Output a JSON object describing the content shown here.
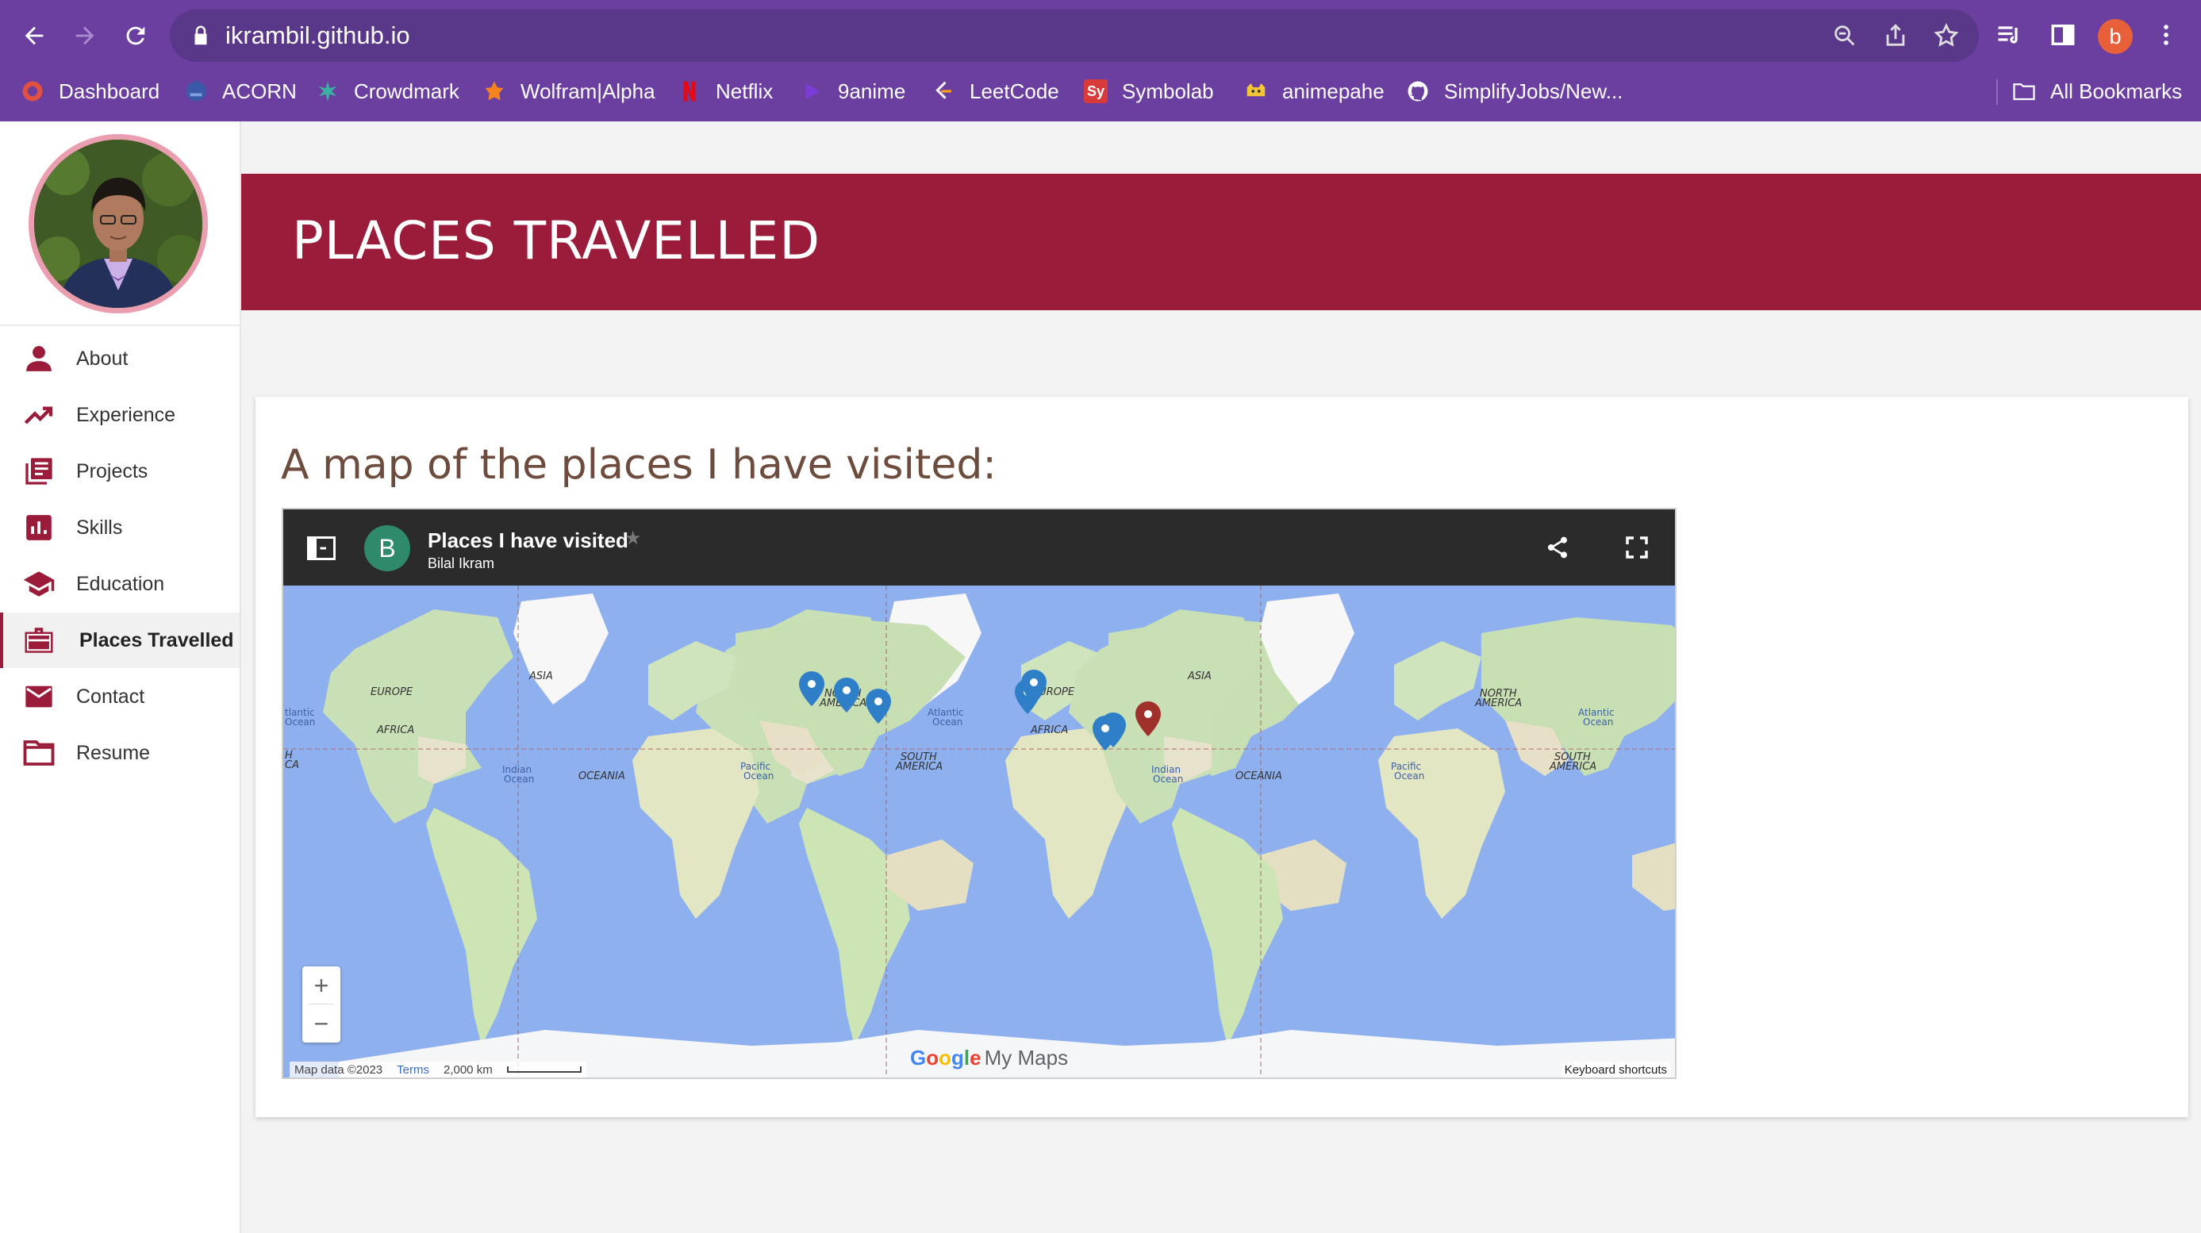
{
  "browser": {
    "url": "ikrambil.github.io",
    "profile_initial": "b",
    "bookmarks": [
      {
        "label": "Dashboard",
        "icon": "dashboard-favicon"
      },
      {
        "label": "ACORN",
        "icon": "acorn-favicon"
      },
      {
        "label": "Crowdmark",
        "icon": "crowdmark-favicon"
      },
      {
        "label": "Wolfram|Alpha",
        "icon": "wolfram-favicon"
      },
      {
        "label": "Netflix",
        "icon": "netflix-favicon"
      },
      {
        "label": "9anime",
        "icon": "9anime-favicon"
      },
      {
        "label": "LeetCode",
        "icon": "leetcode-favicon"
      },
      {
        "label": "Symbolab",
        "icon": "symbolab-favicon",
        "badge": "Sy"
      },
      {
        "label": "animepahe",
        "icon": "animepahe-favicon"
      },
      {
        "label": "SimplifyJobs/New...",
        "icon": "github-favicon"
      }
    ],
    "all_bookmarks_label": "All Bookmarks"
  },
  "sidebar": {
    "items": [
      {
        "label": "About",
        "icon": "person-icon"
      },
      {
        "label": "Experience",
        "icon": "trending-up-icon"
      },
      {
        "label": "Projects",
        "icon": "library-icon"
      },
      {
        "label": "Skills",
        "icon": "bar-chart-icon"
      },
      {
        "label": "Education",
        "icon": "graduation-cap-icon"
      },
      {
        "label": "Places Travelled",
        "icon": "briefcase-icon",
        "active": true
      },
      {
        "label": "Contact",
        "icon": "mail-icon"
      },
      {
        "label": "Resume",
        "icon": "folder-icon"
      }
    ]
  },
  "main": {
    "banner_title": "PLACES TRAVELLED",
    "section_heading": "A map of the places I have visited:"
  },
  "map": {
    "title": "Places I have visited",
    "owner": "Bilal Ikram",
    "owner_initial": "B",
    "labels": {
      "asia": "ASIA",
      "europe": "EUROPE",
      "africa": "AFRICA",
      "north_america_1": "NORTH",
      "north_america_2": "AMERICA",
      "south_america_1": "SOUTH",
      "south_america_2": "AMERICA",
      "oceania": "OCEANIA",
      "atlantic_1": "Atlantic",
      "atlantic_2": "Ocean",
      "indian_1": "Indian",
      "indian_2": "Ocean",
      "pacific_1": "Pacific",
      "pacific_2": "Ocean",
      "partial_atlantic_1": "tlantic",
      "partial_atlantic_2": "Ocean",
      "partial_sa_1": "H",
      "partial_sa_2": "CA"
    },
    "zoom_in": "+",
    "zoom_out": "−",
    "footer_data": "Map data ©2023",
    "footer_terms": "Terms",
    "footer_scale": "2,000 km",
    "keyboard_shortcuts": "Keyboard shortcuts",
    "logo_letters": [
      "G",
      "o",
      "o",
      "g",
      "l",
      "e"
    ],
    "logo_suffix": "My Maps"
  },
  "colors": {
    "browser_frame": "#6b3fa0",
    "accent": "#9b1c3a",
    "profile_ring": "#eb9eb0",
    "heading_brown": "#6d4c3d",
    "map_water": "#8fb0ef",
    "marker_blue": "#2f7fc8",
    "marker_red": "#a0312a"
  }
}
